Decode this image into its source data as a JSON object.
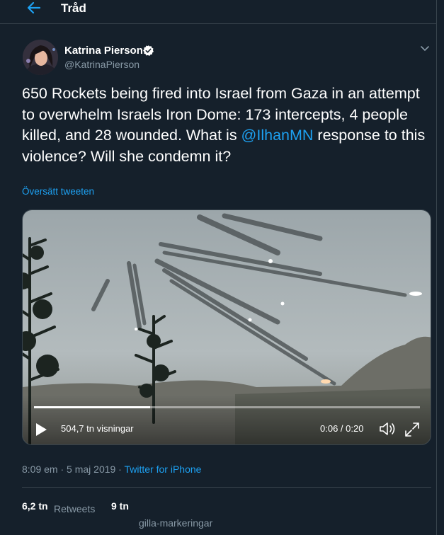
{
  "header": {
    "title": "Tråd",
    "back_icon": "arrow-left-icon"
  },
  "tweet": {
    "display_name": "Katrina Pierson",
    "handle": "@KatrinaPierson",
    "text_before_mention": "650 Rockets being fired into Israel from Gaza in an attempt to overwhelm Israels Iron Dome: 173 intercepts, 4 people killed, and 28 wounded. What is ",
    "mention": "@IlhanMN",
    "text_after_mention": " response to this violence? Will she condemn it?",
    "translate_label": "Översätt tweeten"
  },
  "video": {
    "views": "504,7 tn visningar",
    "time": "0:06 / 0:20",
    "progress": 0.3
  },
  "meta": {
    "timestamp": "8:09 em · 5 maj 2019 · ",
    "source": "Twitter for iPhone"
  },
  "stats": {
    "retweets_count": "6,2 tn",
    "retweets_label": "Retweets",
    "likes_count": "9 tn",
    "likes_label": "gilla-markeringar"
  },
  "colors": {
    "background": "#15202b",
    "accent": "#1da1f2",
    "secondary_text": "#8899a6",
    "border": "#38444d"
  }
}
